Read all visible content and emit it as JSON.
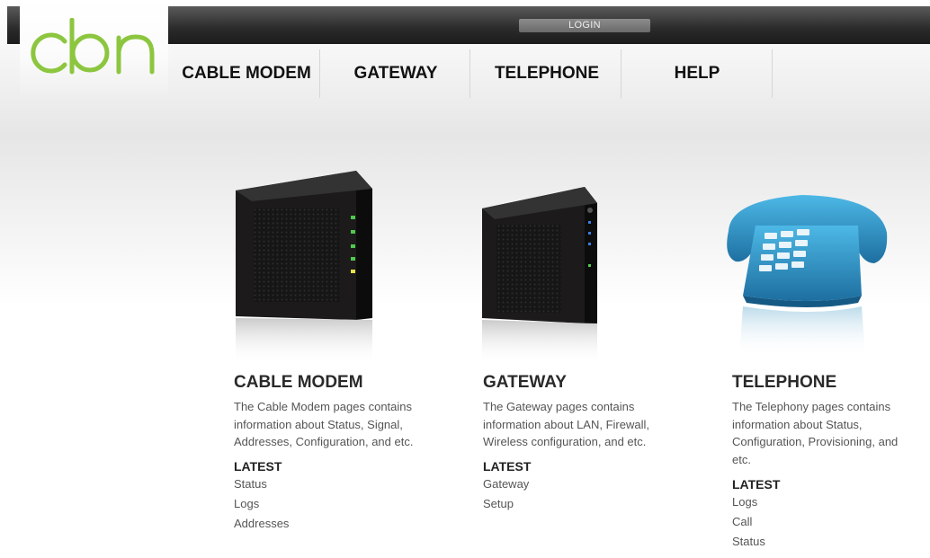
{
  "header": {
    "logo_text": "cbn",
    "login_label": "LOGIN"
  },
  "nav": {
    "items": [
      "CABLE MODEM",
      "GATEWAY",
      "TELEPHONE",
      "HELP"
    ]
  },
  "sections": [
    {
      "title": "CABLE MODEM",
      "description": "The Cable Modem pages contains information about Status, Signal, Addresses, Configuration, and etc.",
      "latest_heading": "LATEST",
      "links": [
        "Status",
        "Logs",
        "Addresses"
      ]
    },
    {
      "title": "GATEWAY",
      "description": "The Gateway pages contains information about LAN, Firewall, Wireless configuration, and etc.",
      "latest_heading": "LATEST",
      "links": [
        "Gateway",
        "Setup"
      ]
    },
    {
      "title": "TELEPHONE",
      "description": "The Telephony pages contains information about Status, Configuration, Provisioning, and etc.",
      "latest_heading": "LATEST",
      "links": [
        "Logs",
        "Call",
        "Status"
      ]
    }
  ],
  "colors": {
    "logo_green": "#8cc63f",
    "topbar": "#2a2a2a",
    "phone_blue": "#2a8fc0"
  }
}
